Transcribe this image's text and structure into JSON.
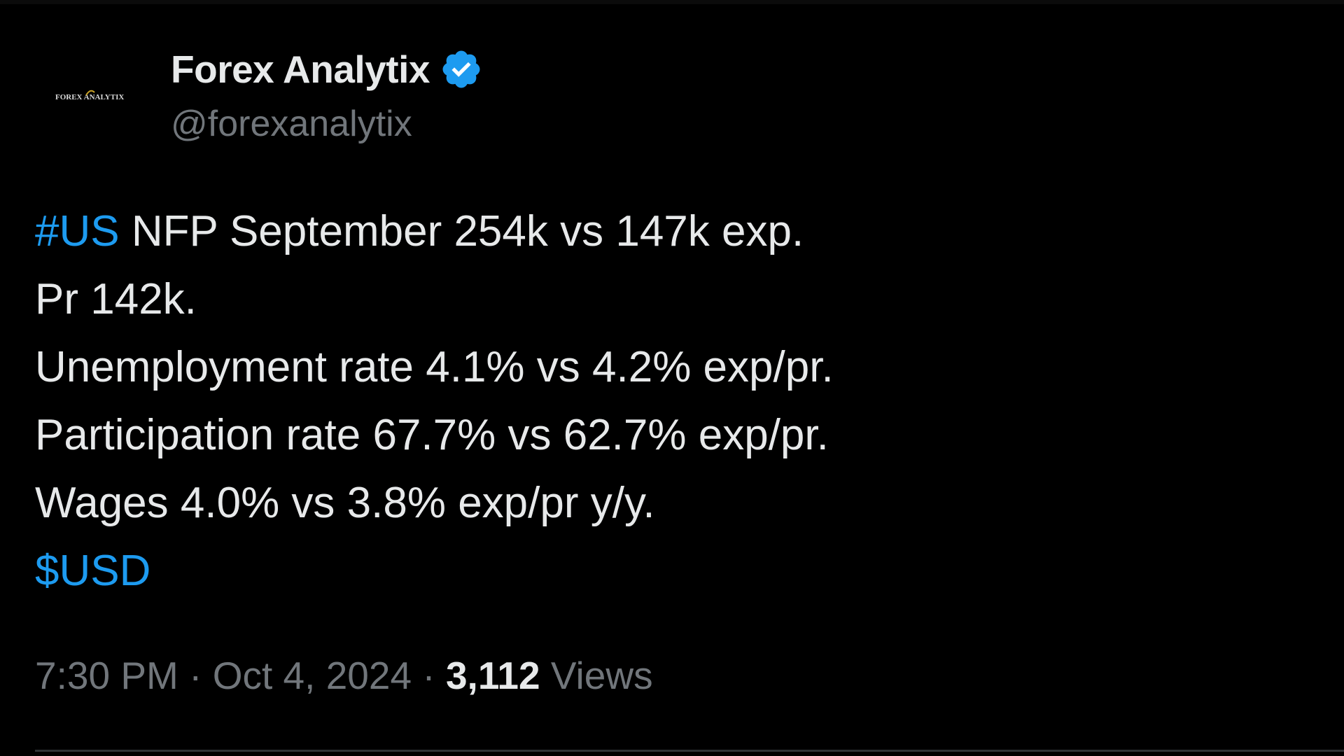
{
  "author": {
    "display_name": "Forex Analytix",
    "handle": "@forexanalytix",
    "avatar_icon": "forex-analytix-logo",
    "avatar_logo_text": "FOREX ANALYTIX",
    "verified": true,
    "verified_icon": "verified-badge-icon"
  },
  "tweet": {
    "line1_hashtag": "#US",
    "line1_text": " NFP September 254k vs 147k exp.",
    "line2": "Pr 142k.",
    "line3": "Unemployment rate 4.1% vs 4.2% exp/pr.",
    "line4": "Participation rate 67.7% vs 62.7% exp/pr.",
    "line5": "Wages 4.0% vs 3.8% exp/pr y/y.",
    "cashtag": "$USD"
  },
  "meta": {
    "time": "7:30 PM",
    "separator": " · ",
    "date": "Oct 4, 2024",
    "views_count": "3,112",
    "views_label": " Views"
  },
  "colors": {
    "background": "#000000",
    "text_primary": "#e7e9ea",
    "text_secondary": "#71767b",
    "link": "#1d9bf0",
    "verified": "#1d9bf0",
    "divider": "#2f3336"
  }
}
